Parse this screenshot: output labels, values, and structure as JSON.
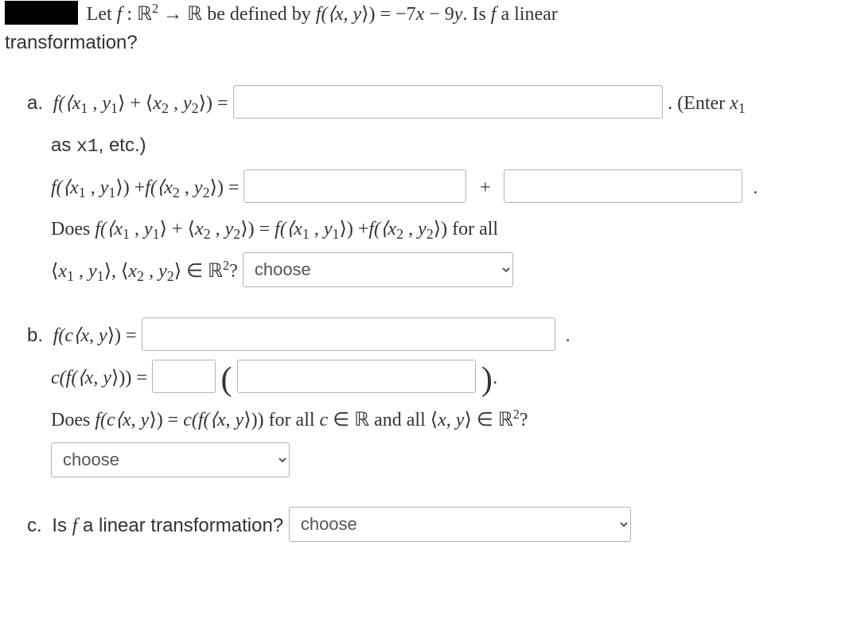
{
  "intro": {
    "let": "Let",
    "f": "f",
    "colon": " : ",
    "R": "ℝ",
    "sq": "2",
    "arrow": " → ",
    "defined": " be defined by ",
    "fxy_lhs_open": "f(⟨",
    "x": "x",
    "comma": ", ",
    "y": "y",
    "fxy_lhs_close": "⟩) = ",
    "rhs_m7": "−7",
    "rhs_minus": " − 9",
    "period": ".",
    "is": " Is ",
    "linear": " a linear",
    "transformation": "transformation?"
  },
  "a": {
    "label": "a.",
    "line1": {
      "f_open": "f(⟨",
      "x1": "x",
      "x1s": "1",
      "c": " , ",
      "y1": "y",
      "y1s": "1",
      "mid": "⟩ + ⟨",
      "x2": "x",
      "x2s": "2",
      "y2": "y",
      "y2s": "2",
      "close": "⟩) = "
    },
    "enter_prefix": ". (Enter ",
    "enter_x": "x",
    "enter_x_sub": "1",
    "as": "as ",
    "x1tt": "x1",
    "etc": ", etc.)",
    "line2": {
      "f1_open": "f(⟨",
      "mid": "⟩) +",
      "f2_open": "f(⟨",
      "close": "⟩) = ",
      "plus": "+",
      "period": "."
    },
    "does_prefix": "Does ",
    "does_mid": " = ",
    "for_all": " for all",
    "in_R2": " ∈ ",
    "q": "?",
    "choose": "choose"
  },
  "b": {
    "label": "b.",
    "l1_open": "f(c⟨",
    "l1_close": "⟩) = ",
    "period": ".",
    "l2_open": "c(f(⟨",
    "l2_close": "⟩)) = ",
    "lparen": "(",
    "rparen": ")",
    "does_prefix": "Does ",
    "for_all_c": " for all ",
    "c": "c",
    "in": " ∈ ",
    "R": "ℝ",
    "and_all": " and all ",
    "choose_placeholder": "choose"
  },
  "c": {
    "label": "c.",
    "text": "Is ",
    "f": "f",
    "rest": " a linear transformation?",
    "choose": "choose"
  }
}
